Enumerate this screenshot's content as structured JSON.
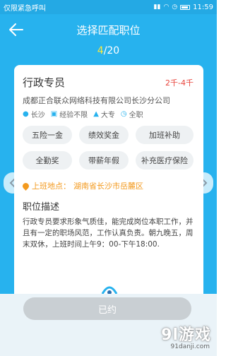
{
  "status_bar": {
    "carrier": "仅限紧急呼叫",
    "time": "11:59"
  },
  "header": {
    "title": "选择匹配职位",
    "back_icon": "arrow-left-icon"
  },
  "counter": {
    "current": "4",
    "total": "/20"
  },
  "job": {
    "title": "行政专员",
    "salary": "2千-4千",
    "company": "成都正合联众网络科技有限公司长沙分公司",
    "tags": [
      {
        "icon": "location-icon",
        "label": "长沙"
      },
      {
        "icon": "briefcase-icon",
        "label": "经验不限"
      },
      {
        "icon": "graduation-cap-icon",
        "label": "大专"
      },
      {
        "icon": "clock-icon",
        "label": "全职"
      }
    ],
    "benefits": [
      "五险一金",
      "绩效奖金",
      "加班补助",
      "全勤奖",
      "带薪年假",
      "补充医疗保险"
    ],
    "location_label": "上班地点：",
    "location_value": "湖南省长沙市岳麓区",
    "desc_heading": "职位描述",
    "desc_text": "行政专员要求形象气质佳，能完成岗位本职工作，并且有一定的职场风范，工作认真负责。朝九晚五，周末双休，上班时间上午9：00-下午18:00."
  },
  "footer": {
    "button_label": "已约"
  },
  "watermark": {
    "logo_text": "9l游戏",
    "url": "91danji.com"
  },
  "colors": {
    "primary": "#27b2ee",
    "salary": "#e8443c",
    "location": "#f39a1f",
    "counter_current": "#ffea3a",
    "disabled_button": "#c9cfd3"
  }
}
